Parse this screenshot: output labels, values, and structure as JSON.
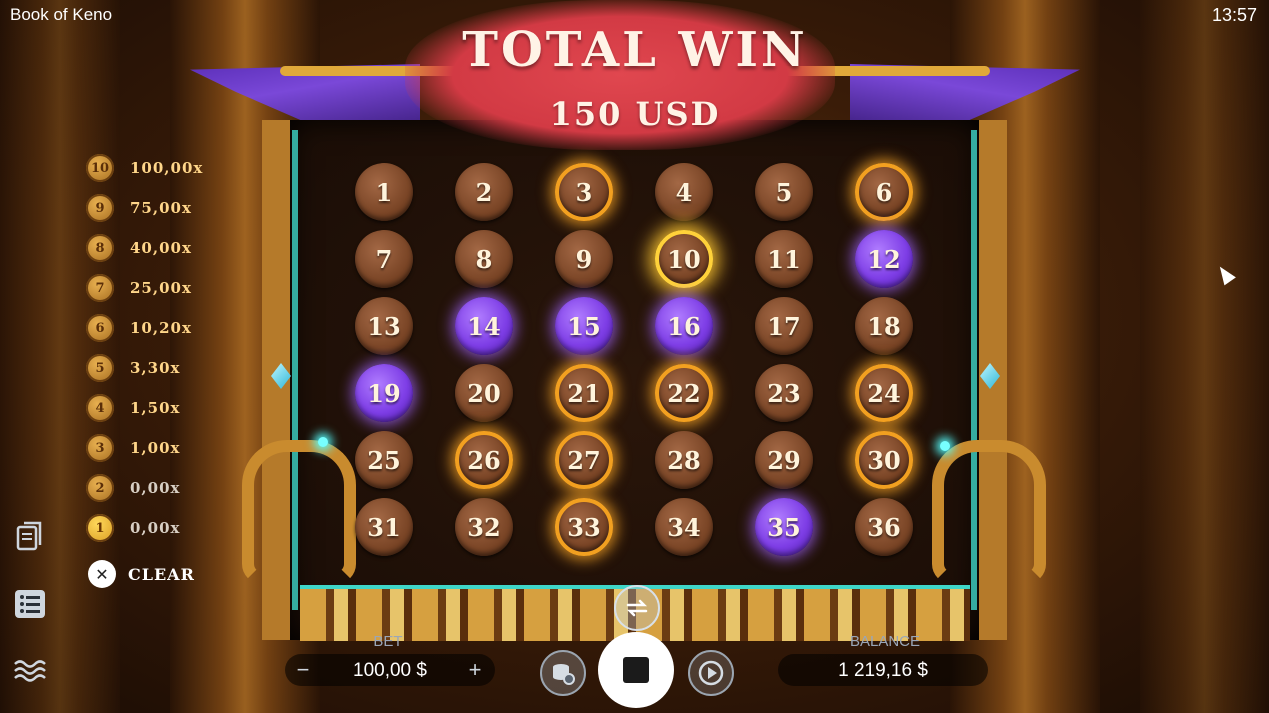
{
  "app": {
    "title": "Book of Keno",
    "time": "13:57"
  },
  "win": {
    "title": "TOTAL WIN",
    "amount": "150 USD"
  },
  "paytable": [
    {
      "hits": "10",
      "multiplier": "100,00x"
    },
    {
      "hits": "9",
      "multiplier": "75,00x"
    },
    {
      "hits": "8",
      "multiplier": "40,00x"
    },
    {
      "hits": "7",
      "multiplier": "25,00x"
    },
    {
      "hits": "6",
      "multiplier": "10,20x"
    },
    {
      "hits": "5",
      "multiplier": "3,30x"
    },
    {
      "hits": "4",
      "multiplier": "1,50x"
    },
    {
      "hits": "3",
      "multiplier": "1,00x"
    },
    {
      "hits": "2",
      "multiplier": "0,00x"
    },
    {
      "hits": "1",
      "multiplier": "0,00x"
    }
  ],
  "clear_label": "CLEAR",
  "grid": {
    "numbers": [
      "1",
      "2",
      "3",
      "4",
      "5",
      "6",
      "7",
      "8",
      "9",
      "10",
      "11",
      "12",
      "13",
      "14",
      "15",
      "16",
      "17",
      "18",
      "19",
      "20",
      "21",
      "22",
      "23",
      "24",
      "25",
      "26",
      "27",
      "28",
      "29",
      "30",
      "31",
      "32",
      "33",
      "34",
      "35",
      "36"
    ],
    "selected": [
      12,
      14,
      15,
      16,
      19,
      35
    ],
    "drawn": [
      3,
      6,
      21,
      22,
      24,
      26,
      27,
      30,
      33
    ],
    "hit": [
      10
    ]
  },
  "bet": {
    "label": "BET",
    "value": "100,00 $",
    "minus": "−",
    "plus": "+"
  },
  "balance": {
    "label": "BALANCE",
    "value": "1 219,16 $"
  },
  "icons": {
    "paytable_doc": "document-icon",
    "history_list": "list-icon",
    "menu_waves": "waves-icon",
    "coins_settings": "coins-settings-icon",
    "stop": "stop-icon",
    "autoplay": "autoplay-icon",
    "swap": "swap-icon",
    "clear": "clear-tools-icon"
  },
  "colors": {
    "selected": "#7e3ee6",
    "drawn_ring": "#f2a020",
    "win_cloud": "#d23a44",
    "paytable_gold": "#ffd68a"
  }
}
